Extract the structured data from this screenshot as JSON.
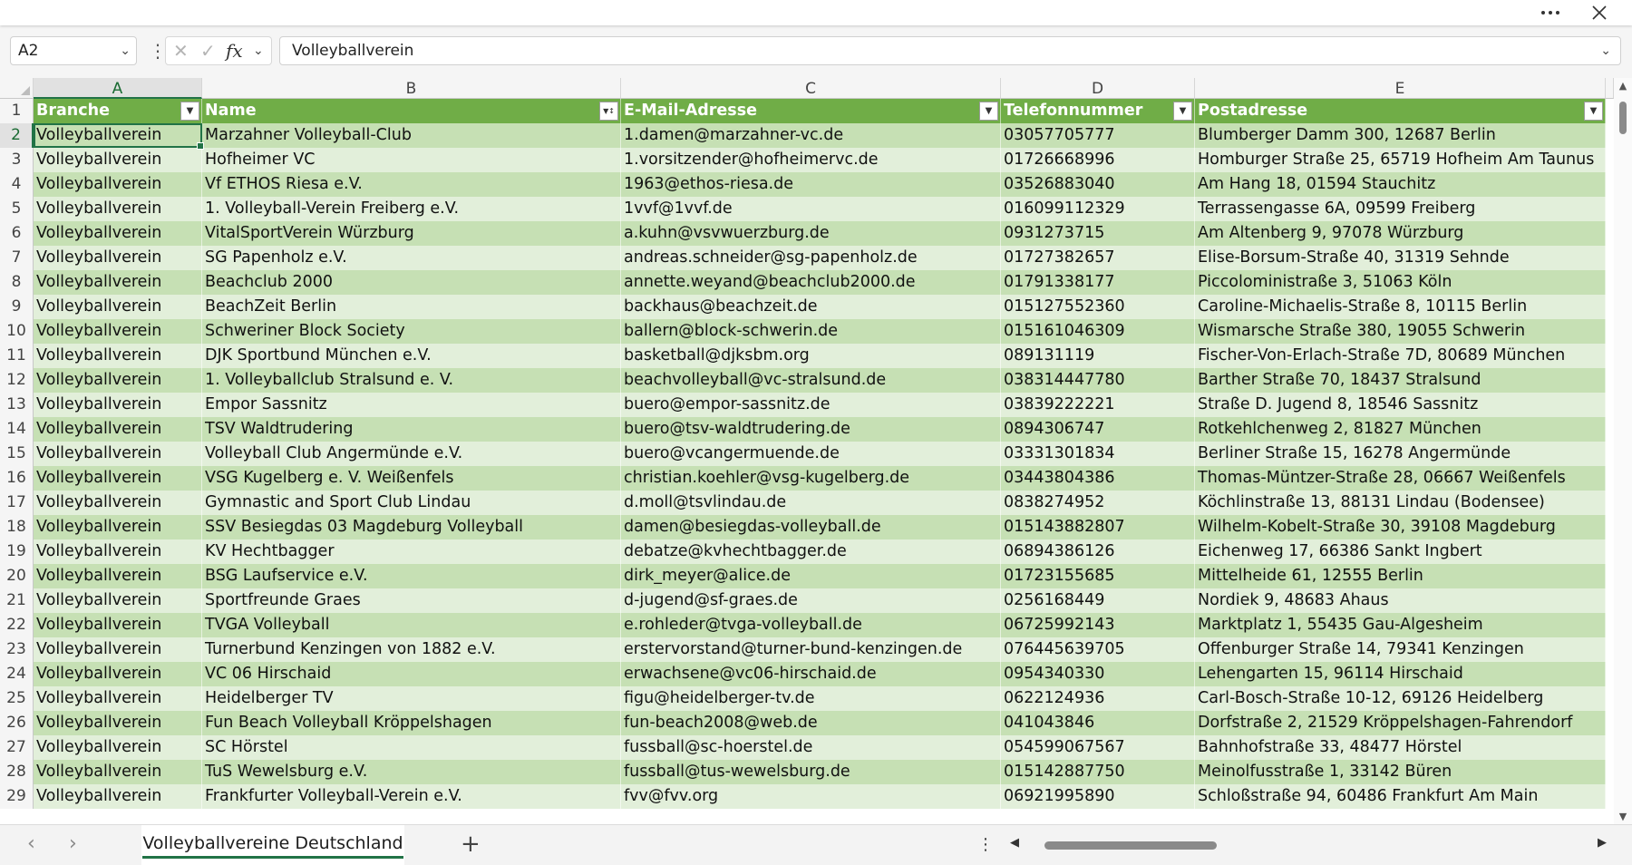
{
  "titlebar": {
    "more_icon": "more-horizontal-icon",
    "close_icon": "close-icon"
  },
  "formula_bar": {
    "name_box": "A2",
    "formula": "Volleyballverein",
    "fx_label": "fx"
  },
  "columns": [
    "A",
    "B",
    "C",
    "D",
    "E"
  ],
  "header": [
    "Branche",
    "Name",
    "E-Mail-Adresse",
    "Telefonnummer",
    "Postadresse"
  ],
  "rows": [
    [
      "Volleyballverein",
      "Marzahner Volleyball-Club",
      "1.damen@marzahner-vc.de",
      "03057705777",
      "Blumberger Damm 300, 12687 Berlin"
    ],
    [
      "Volleyballverein",
      "Hofheimer VC",
      "1.vorsitzender@hofheimervc.de",
      "01726668996",
      "Homburger Straße 25, 65719 Hofheim Am Taunus"
    ],
    [
      "Volleyballverein",
      "Vf ETHOS Riesa e.V.",
      "1963@ethos-riesa.de",
      "03526883040",
      "Am Hang 18, 01594 Stauchitz"
    ],
    [
      "Volleyballverein",
      "1. Volleyball-Verein Freiberg e.V.",
      "1vvf@1vvf.de",
      "016099112329",
      "Terrassengasse 6A, 09599 Freiberg"
    ],
    [
      "Volleyballverein",
      "VitalSportVerein Würzburg",
      "a.kuhn@vsvwuerzburg.de",
      "0931273715",
      "Am Altenberg 9, 97078 Würzburg"
    ],
    [
      "Volleyballverein",
      "SG Papenholz e.V.",
      "andreas.schneider@sg-papenholz.de",
      "01727382657",
      "Elise-Borsum-Straße 40, 31319 Sehnde"
    ],
    [
      "Volleyballverein",
      "Beachclub 2000",
      "annette.weyand@beachclub2000.de",
      "01791338177",
      "Piccoloministraße 3, 51063 Köln"
    ],
    [
      "Volleyballverein",
      "BeachZeit Berlin",
      "backhaus@beachzeit.de",
      "015127552360",
      "Caroline-Michaelis-Straße 8, 10115 Berlin"
    ],
    [
      "Volleyballverein",
      "Schweriner Block Society",
      "ballern@block-schwerin.de",
      "015161046309",
      "Wismarsche Straße 380, 19055 Schwerin"
    ],
    [
      "Volleyballverein",
      "DJK Sportbund München e.V.",
      "basketball@djksbm.org",
      "089131119",
      "Fischer-Von-Erlach-Straße 7D, 80689 München"
    ],
    [
      "Volleyballverein",
      "1. Volleyballclub Stralsund e. V.",
      "beachvolleyball@vc-stralsund.de",
      "038314447780",
      "Barther Straße 70, 18437 Stralsund"
    ],
    [
      "Volleyballverein",
      "Empor Sassnitz",
      "buero@empor-sassnitz.de",
      "03839222221",
      "Straße D. Jugend 8, 18546 Sassnitz"
    ],
    [
      "Volleyballverein",
      "TSV Waldtrudering",
      "buero@tsv-waldtrudering.de",
      "0894306747",
      "Rotkehlchenweg 2, 81827 München"
    ],
    [
      "Volleyballverein",
      "Volleyball Club Angermünde e.V.",
      "buero@vcangermuende.de",
      "03331301834",
      "Berliner Straße 15, 16278 Angermünde"
    ],
    [
      "Volleyballverein",
      "VSG Kugelberg e. V. Weißenfels",
      "christian.koehler@vsg-kugelberg.de",
      "03443804386",
      "Thomas-Müntzer-Straße 28, 06667 Weißenfels"
    ],
    [
      "Volleyballverein",
      "Gymnastic and Sport Club Lindau",
      "d.moll@tsvlindau.de",
      "0838274952",
      "Köchlinstraße 13, 88131 Lindau (Bodensee)"
    ],
    [
      "Volleyballverein",
      "SSV Besiegdas 03 Magdeburg Volleyball",
      "damen@besiegdas-volleyball.de",
      "015143882807",
      "Wilhelm-Kobelt-Straße 30, 39108 Magdeburg"
    ],
    [
      "Volleyballverein",
      "KV Hechtbagger",
      "debatze@kvhechtbagger.de",
      "06894386126",
      "Eichenweg 17, 66386 Sankt Ingbert"
    ],
    [
      "Volleyballverein",
      "BSG Laufservice e.V.",
      "dirk_meyer@alice.de",
      "01723155685",
      "Mittelheide 61, 12555 Berlin"
    ],
    [
      "Volleyballverein",
      "Sportfreunde Graes",
      "d-jugend@sf-graes.de",
      "0256168449",
      "Nordiek 9, 48683 Ahaus"
    ],
    [
      "Volleyballverein",
      "TVGA Volleyball",
      "e.rohleder@tvga-volleyball.de",
      "06725992143",
      "Marktplatz 1, 55435 Gau-Algesheim"
    ],
    [
      "Volleyballverein",
      "Turnerbund Kenzingen von 1882 e.V.",
      "erstervorstand@turner-bund-kenzingen.de",
      "076445639705",
      "Offenburger Straße 14, 79341 Kenzingen"
    ],
    [
      "Volleyballverein",
      "VC 06 Hirschaid",
      "erwachsene@vc06-hirschaid.de",
      "0954340330",
      "Lehengarten 15, 96114 Hirschaid"
    ],
    [
      "Volleyballverein",
      "Heidelberger TV",
      "figu@heidelberger-tv.de",
      "0622124936",
      "Carl-Bosch-Straße 10-12, 69126 Heidelberg"
    ],
    [
      "Volleyballverein",
      "Fun Beach Volleyball Kröppelshagen",
      "fun-beach2008@web.de",
      "041043846",
      "Dorfstraße 2, 21529 Kröppelshagen-Fahrendorf"
    ],
    [
      "Volleyballverein",
      "SC Hörstel",
      "fussball@sc-hoerstel.de",
      "054599067567",
      "Bahnhofstraße 33, 48477 Hörstel"
    ],
    [
      "Volleyballverein",
      "TuS Wewelsburg e.V.",
      "fussball@tus-wewelsburg.de",
      "015142887750",
      "Meinolfusstraße 1, 33142 Büren"
    ],
    [
      "Volleyballverein",
      "Frankfurter Volleyball-Verein e.V.",
      "fvv@fvv.org",
      "06921995890",
      "Schloßstraße 94, 60486 Frankfurt Am Main"
    ]
  ],
  "sheet_tab": "Volleyballvereine Deutschland",
  "colors": {
    "header": "#70ad47",
    "band": "#c6e0b4",
    "plain": "#e2efda",
    "accent": "#217346"
  }
}
